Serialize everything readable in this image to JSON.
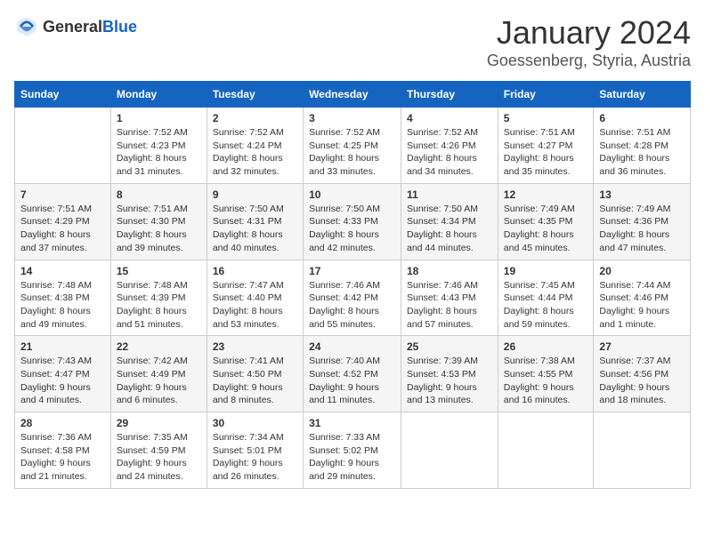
{
  "header": {
    "logo_general": "General",
    "logo_blue": "Blue",
    "month": "January 2024",
    "location": "Goessenberg, Styria, Austria"
  },
  "weekdays": [
    "Sunday",
    "Monday",
    "Tuesday",
    "Wednesday",
    "Thursday",
    "Friday",
    "Saturday"
  ],
  "weeks": [
    [
      {
        "day": "",
        "sunrise": "",
        "sunset": "",
        "daylight": ""
      },
      {
        "day": "1",
        "sunrise": "Sunrise: 7:52 AM",
        "sunset": "Sunset: 4:23 PM",
        "daylight": "Daylight: 8 hours and 31 minutes."
      },
      {
        "day": "2",
        "sunrise": "Sunrise: 7:52 AM",
        "sunset": "Sunset: 4:24 PM",
        "daylight": "Daylight: 8 hours and 32 minutes."
      },
      {
        "day": "3",
        "sunrise": "Sunrise: 7:52 AM",
        "sunset": "Sunset: 4:25 PM",
        "daylight": "Daylight: 8 hours and 33 minutes."
      },
      {
        "day": "4",
        "sunrise": "Sunrise: 7:52 AM",
        "sunset": "Sunset: 4:26 PM",
        "daylight": "Daylight: 8 hours and 34 minutes."
      },
      {
        "day": "5",
        "sunrise": "Sunrise: 7:51 AM",
        "sunset": "Sunset: 4:27 PM",
        "daylight": "Daylight: 8 hours and 35 minutes."
      },
      {
        "day": "6",
        "sunrise": "Sunrise: 7:51 AM",
        "sunset": "Sunset: 4:28 PM",
        "daylight": "Daylight: 8 hours and 36 minutes."
      }
    ],
    [
      {
        "day": "7",
        "sunrise": "Sunrise: 7:51 AM",
        "sunset": "Sunset: 4:29 PM",
        "daylight": "Daylight: 8 hours and 37 minutes."
      },
      {
        "day": "8",
        "sunrise": "Sunrise: 7:51 AM",
        "sunset": "Sunset: 4:30 PM",
        "daylight": "Daylight: 8 hours and 39 minutes."
      },
      {
        "day": "9",
        "sunrise": "Sunrise: 7:50 AM",
        "sunset": "Sunset: 4:31 PM",
        "daylight": "Daylight: 8 hours and 40 minutes."
      },
      {
        "day": "10",
        "sunrise": "Sunrise: 7:50 AM",
        "sunset": "Sunset: 4:33 PM",
        "daylight": "Daylight: 8 hours and 42 minutes."
      },
      {
        "day": "11",
        "sunrise": "Sunrise: 7:50 AM",
        "sunset": "Sunset: 4:34 PM",
        "daylight": "Daylight: 8 hours and 44 minutes."
      },
      {
        "day": "12",
        "sunrise": "Sunrise: 7:49 AM",
        "sunset": "Sunset: 4:35 PM",
        "daylight": "Daylight: 8 hours and 45 minutes."
      },
      {
        "day": "13",
        "sunrise": "Sunrise: 7:49 AM",
        "sunset": "Sunset: 4:36 PM",
        "daylight": "Daylight: 8 hours and 47 minutes."
      }
    ],
    [
      {
        "day": "14",
        "sunrise": "Sunrise: 7:48 AM",
        "sunset": "Sunset: 4:38 PM",
        "daylight": "Daylight: 8 hours and 49 minutes."
      },
      {
        "day": "15",
        "sunrise": "Sunrise: 7:48 AM",
        "sunset": "Sunset: 4:39 PM",
        "daylight": "Daylight: 8 hours and 51 minutes."
      },
      {
        "day": "16",
        "sunrise": "Sunrise: 7:47 AM",
        "sunset": "Sunset: 4:40 PM",
        "daylight": "Daylight: 8 hours and 53 minutes."
      },
      {
        "day": "17",
        "sunrise": "Sunrise: 7:46 AM",
        "sunset": "Sunset: 4:42 PM",
        "daylight": "Daylight: 8 hours and 55 minutes."
      },
      {
        "day": "18",
        "sunrise": "Sunrise: 7:46 AM",
        "sunset": "Sunset: 4:43 PM",
        "daylight": "Daylight: 8 hours and 57 minutes."
      },
      {
        "day": "19",
        "sunrise": "Sunrise: 7:45 AM",
        "sunset": "Sunset: 4:44 PM",
        "daylight": "Daylight: 8 hours and 59 minutes."
      },
      {
        "day": "20",
        "sunrise": "Sunrise: 7:44 AM",
        "sunset": "Sunset: 4:46 PM",
        "daylight": "Daylight: 9 hours and 1 minute."
      }
    ],
    [
      {
        "day": "21",
        "sunrise": "Sunrise: 7:43 AM",
        "sunset": "Sunset: 4:47 PM",
        "daylight": "Daylight: 9 hours and 4 minutes."
      },
      {
        "day": "22",
        "sunrise": "Sunrise: 7:42 AM",
        "sunset": "Sunset: 4:49 PM",
        "daylight": "Daylight: 9 hours and 6 minutes."
      },
      {
        "day": "23",
        "sunrise": "Sunrise: 7:41 AM",
        "sunset": "Sunset: 4:50 PM",
        "daylight": "Daylight: 9 hours and 8 minutes."
      },
      {
        "day": "24",
        "sunrise": "Sunrise: 7:40 AM",
        "sunset": "Sunset: 4:52 PM",
        "daylight": "Daylight: 9 hours and 11 minutes."
      },
      {
        "day": "25",
        "sunrise": "Sunrise: 7:39 AM",
        "sunset": "Sunset: 4:53 PM",
        "daylight": "Daylight: 9 hours and 13 minutes."
      },
      {
        "day": "26",
        "sunrise": "Sunrise: 7:38 AM",
        "sunset": "Sunset: 4:55 PM",
        "daylight": "Daylight: 9 hours and 16 minutes."
      },
      {
        "day": "27",
        "sunrise": "Sunrise: 7:37 AM",
        "sunset": "Sunset: 4:56 PM",
        "daylight": "Daylight: 9 hours and 18 minutes."
      }
    ],
    [
      {
        "day": "28",
        "sunrise": "Sunrise: 7:36 AM",
        "sunset": "Sunset: 4:58 PM",
        "daylight": "Daylight: 9 hours and 21 minutes."
      },
      {
        "day": "29",
        "sunrise": "Sunrise: 7:35 AM",
        "sunset": "Sunset: 4:59 PM",
        "daylight": "Daylight: 9 hours and 24 minutes."
      },
      {
        "day": "30",
        "sunrise": "Sunrise: 7:34 AM",
        "sunset": "Sunset: 5:01 PM",
        "daylight": "Daylight: 9 hours and 26 minutes."
      },
      {
        "day": "31",
        "sunrise": "Sunrise: 7:33 AM",
        "sunset": "Sunset: 5:02 PM",
        "daylight": "Daylight: 9 hours and 29 minutes."
      },
      {
        "day": "",
        "sunrise": "",
        "sunset": "",
        "daylight": ""
      },
      {
        "day": "",
        "sunrise": "",
        "sunset": "",
        "daylight": ""
      },
      {
        "day": "",
        "sunrise": "",
        "sunset": "",
        "daylight": ""
      }
    ]
  ]
}
